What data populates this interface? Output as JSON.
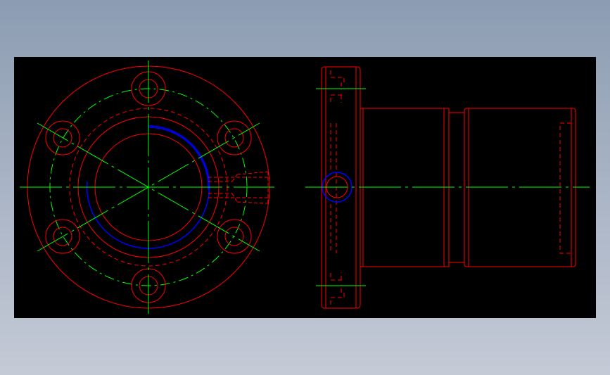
{
  "drawing": {
    "type": "2d-cad-orthographic-views",
    "views": [
      "front-view-flange",
      "side-view-ball-screw-nut"
    ],
    "colors": {
      "background": "#000000",
      "outline": "#ff0000",
      "centerline": "#00ff00",
      "thread": "#0000ff",
      "page": "#9aa6b8"
    },
    "icons": [
      "flange-bolt-hole-icon",
      "lubrication-port-icon"
    ],
    "bolt_hole_count": 6
  }
}
